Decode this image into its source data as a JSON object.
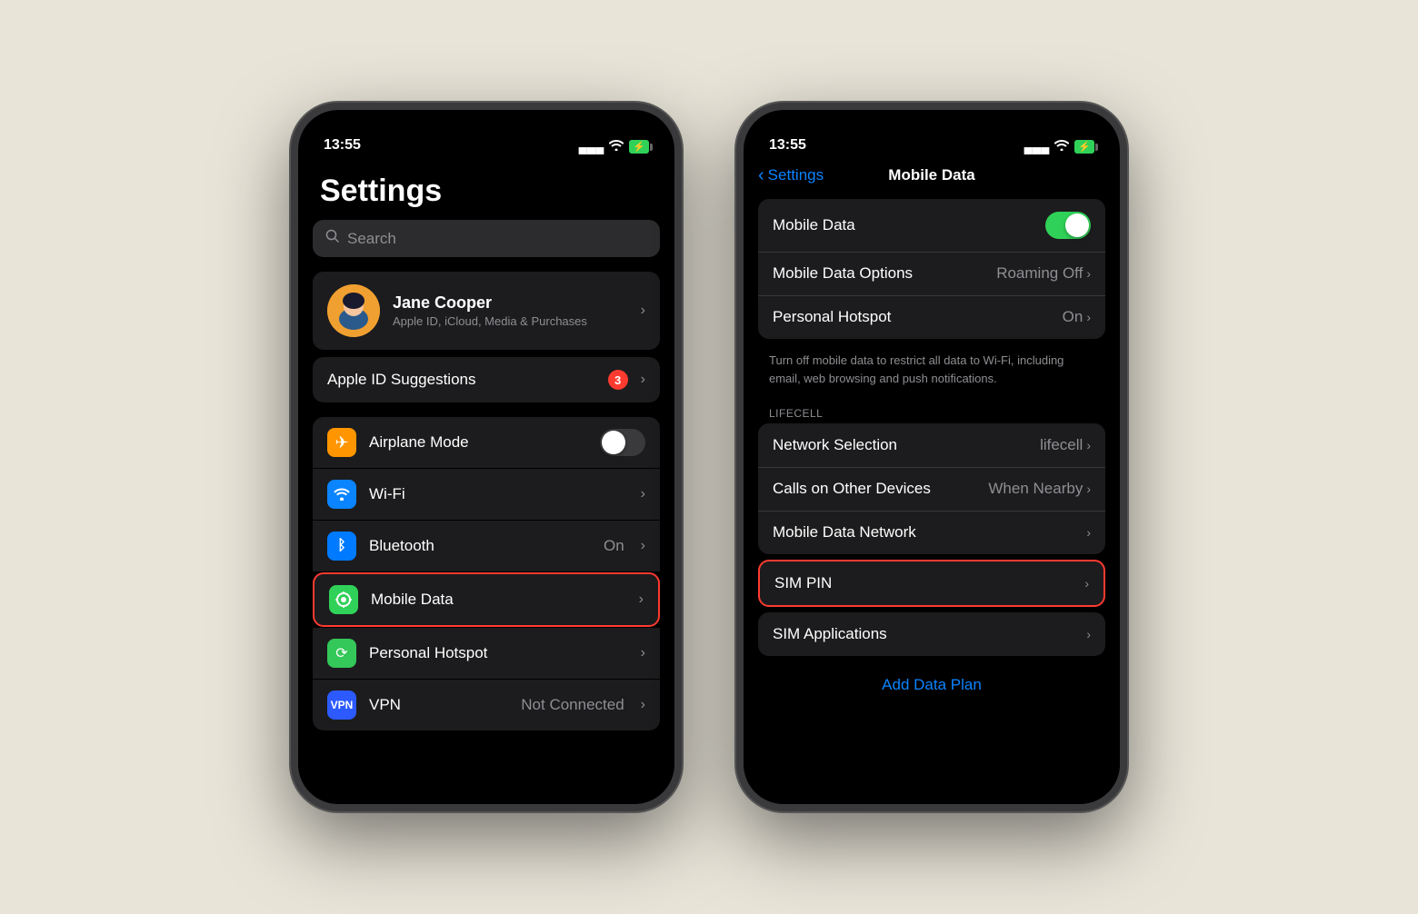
{
  "background": "#e8e4d8",
  "left_phone": {
    "status_bar": {
      "time": "13:55",
      "battery_icon": "⚡",
      "signal_icon": "▄▄▄",
      "wifi_icon": "wifi"
    },
    "title": "Settings",
    "search_placeholder": "Search",
    "profile": {
      "name": "Jane Cooper",
      "subtitle": "Apple ID, iCloud, Media & Purchases",
      "avatar_emoji": "👩"
    },
    "suggestions": {
      "label": "Apple ID Suggestions",
      "badge": "3"
    },
    "settings_rows": [
      {
        "icon": "✈",
        "icon_class": "icon-orange",
        "label": "Airplane Mode",
        "value": "",
        "has_toggle": true,
        "toggle_on": false
      },
      {
        "icon": "📶",
        "icon_class": "icon-blue",
        "label": "Wi-Fi",
        "value": "",
        "has_chevron": true
      },
      {
        "icon": "✦",
        "icon_class": "icon-blue2",
        "label": "Bluetooth",
        "value": "On",
        "has_chevron": true
      },
      {
        "icon": "◉",
        "icon_class": "icon-green",
        "label": "Mobile Data",
        "value": "",
        "has_chevron": true,
        "highlighted": true
      },
      {
        "icon": "∞",
        "icon_class": "icon-green2",
        "label": "Personal Hotspot",
        "value": "",
        "has_chevron": true
      },
      {
        "icon": "VPN",
        "icon_class": "icon-vpn",
        "label": "VPN",
        "value": "Not Connected",
        "has_chevron": true
      }
    ]
  },
  "right_phone": {
    "status_bar": {
      "time": "13:55"
    },
    "nav": {
      "back_label": "Settings",
      "title": "Mobile Data"
    },
    "main_group": [
      {
        "label": "Mobile Data",
        "has_toggle": true,
        "toggle_on": true
      },
      {
        "label": "Mobile Data Options",
        "value": "Roaming Off",
        "has_chevron": true
      },
      {
        "label": "Personal Hotspot",
        "value": "On",
        "has_chevron": true
      }
    ],
    "hint": "Turn off mobile data to restrict all data to Wi-Fi, including email, web browsing and push notifications.",
    "section_label": "LIFECELL",
    "lifecell_group": [
      {
        "label": "Network Selection",
        "value": "lifecell",
        "has_chevron": true
      },
      {
        "label": "Calls on Other Devices",
        "value": "When Nearby",
        "has_chevron": true
      },
      {
        "label": "Mobile Data Network",
        "value": "",
        "has_chevron": true
      },
      {
        "label": "SIM PIN",
        "value": "",
        "has_chevron": true,
        "highlighted": true
      },
      {
        "label": "SIM Applications",
        "value": "",
        "has_chevron": true
      }
    ],
    "add_data_plan": "Add Data Plan"
  }
}
